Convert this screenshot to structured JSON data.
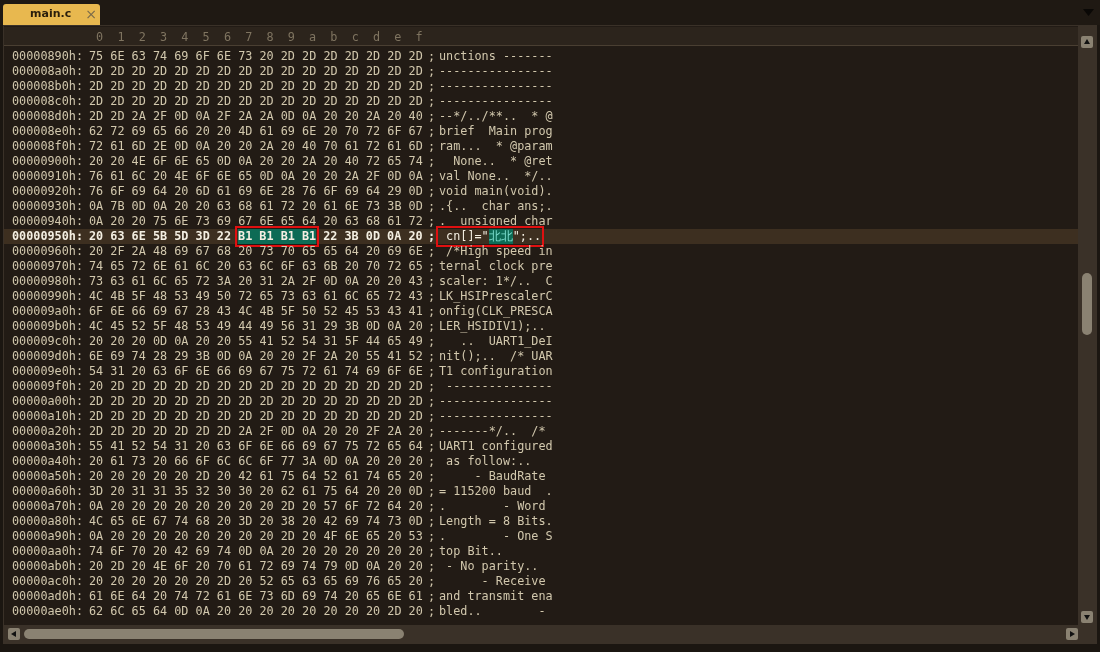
{
  "tabs": [
    {
      "label": "main.c",
      "selected": true,
      "close": "×"
    }
  ],
  "columns": [
    "0",
    "1",
    "2",
    "3",
    "4",
    "5",
    "6",
    "7",
    "8",
    "9",
    "a",
    "b",
    "c",
    "d",
    "e",
    "f"
  ],
  "rows": [
    {
      "address": "00000890h:",
      "hex": "75 6E 63 74 69 6F 6E 73 20 2D 2D 2D 2D 2D 2D 2D",
      "sep": ";",
      "ascii": "unctions -------",
      "current": false
    },
    {
      "address": "000008a0h:",
      "hex": "2D 2D 2D 2D 2D 2D 2D 2D 2D 2D 2D 2D 2D 2D 2D 2D",
      "sep": ";",
      "ascii": "----------------",
      "current": false
    },
    {
      "address": "000008b0h:",
      "hex": "2D 2D 2D 2D 2D 2D 2D 2D 2D 2D 2D 2D 2D 2D 2D 2D",
      "sep": ";",
      "ascii": "----------------",
      "current": false
    },
    {
      "address": "000008c0h:",
      "hex": "2D 2D 2D 2D 2D 2D 2D 2D 2D 2D 2D 2D 2D 2D 2D 2D",
      "sep": ";",
      "ascii": "----------------",
      "current": false
    },
    {
      "address": "000008d0h:",
      "hex": "2D 2D 2A 2F 0D 0A 2F 2A 2A 0D 0A 20 20 2A 20 40",
      "sep": ";",
      "ascii": "--*/../**..  * @",
      "current": false
    },
    {
      "address": "000008e0h:",
      "hex": "62 72 69 65 66 20 20 4D 61 69 6E 20 70 72 6F 67",
      "sep": ";",
      "ascii": "brief  Main prog",
      "current": false
    },
    {
      "address": "000008f0h:",
      "hex": "72 61 6D 2E 0D 0A 20 20 2A 20 40 70 61 72 61 6D",
      "sep": ";",
      "ascii": "ram...  * @param",
      "current": false
    },
    {
      "address": "00000900h:",
      "hex": "20 20 4E 6F 6E 65 0D 0A 20 20 2A 20 40 72 65 74",
      "sep": ";",
      "ascii": "  None..  * @ret",
      "current": false
    },
    {
      "address": "00000910h:",
      "hex": "76 61 6C 20 4E 6F 6E 65 0D 0A 20 20 2A 2F 0D 0A",
      "sep": ";",
      "ascii": "val None..  */..",
      "current": false
    },
    {
      "address": "00000920h:",
      "hex": "76 6F 69 64 20 6D 61 69 6E 28 76 6F 69 64 29 0D",
      "sep": ";",
      "ascii": "void main(void).",
      "current": false
    },
    {
      "address": "00000930h:",
      "hex": "0A 7B 0D 0A 20 20 63 68 61 72 20 61 6E 73 3B 0D",
      "sep": ";",
      "ascii": ".{..  char ans;.",
      "current": false
    },
    {
      "address": "00000940h:",
      "hex": "0A 20 20 75 6E 73 69 67 6E 65 64 20 63 68 61 72",
      "sep": ";",
      "ascii": ".  unsigned char",
      "current": false
    },
    {
      "address": "00000950h:",
      "hex": [
        {
          "text": "20 63 6E 5B 5D 3D 22",
          "selected": false
        },
        {
          "text": "B1 B1 B1 B1",
          "selected": true
        },
        {
          "text": "22 3B 0D 0A 20",
          "selected": false
        }
      ],
      "sep": ";",
      "ascii": [
        {
          "text": " cn[]=\"",
          "selected": false
        },
        {
          "text": "北北",
          "selected": true
        },
        {
          "text": "\";..",
          "selected": false
        }
      ],
      "current": true
    },
    {
      "address": "00000960h:",
      "hex": "20 2F 2A 48 69 67 68 20 73 70 65 65 64 20 69 6E",
      "sep": ";",
      "ascii": " /*High speed in",
      "current": false
    },
    {
      "address": "00000970h:",
      "hex": "74 65 72 6E 61 6C 20 63 6C 6F 63 6B 20 70 72 65",
      "sep": ";",
      "ascii": "ternal clock pre",
      "current": false
    },
    {
      "address": "00000980h:",
      "hex": "73 63 61 6C 65 72 3A 20 31 2A 2F 0D 0A 20 20 43",
      "sep": ";",
      "ascii": "scaler: 1*/..  C",
      "current": false
    },
    {
      "address": "00000990h:",
      "hex": "4C 4B 5F 48 53 49 50 72 65 73 63 61 6C 65 72 43",
      "sep": ";",
      "ascii": "LK_HSIPrescalerC",
      "current": false
    },
    {
      "address": "000009a0h:",
      "hex": "6F 6E 66 69 67 28 43 4C 4B 5F 50 52 45 53 43 41",
      "sep": ";",
      "ascii": "onfig(CLK_PRESCA",
      "current": false
    },
    {
      "address": "000009b0h:",
      "hex": "4C 45 52 5F 48 53 49 44 49 56 31 29 3B 0D 0A 20",
      "sep": ";",
      "ascii": "LER_HSIDIV1);..",
      "current": false
    },
    {
      "address": "000009c0h:",
      "hex": "20 20 20 0D 0A 20 20 55 41 52 54 31 5F 44 65 49",
      "sep": ";",
      "ascii": "   ..  UART1_DeI",
      "current": false
    },
    {
      "address": "000009d0h:",
      "hex": "6E 69 74 28 29 3B 0D 0A 20 20 2F 2A 20 55 41 52",
      "sep": ";",
      "ascii": "nit();..  /* UAR",
      "current": false
    },
    {
      "address": "000009e0h:",
      "hex": "54 31 20 63 6F 6E 66 69 67 75 72 61 74 69 6F 6E",
      "sep": ";",
      "ascii": "T1 configuration",
      "current": false
    },
    {
      "address": "000009f0h:",
      "hex": "20 2D 2D 2D 2D 2D 2D 2D 2D 2D 2D 2D 2D 2D 2D 2D",
      "sep": ";",
      "ascii": " ---------------",
      "current": false
    },
    {
      "address": "00000a00h:",
      "hex": "2D 2D 2D 2D 2D 2D 2D 2D 2D 2D 2D 2D 2D 2D 2D 2D",
      "sep": ";",
      "ascii": "----------------",
      "current": false
    },
    {
      "address": "00000a10h:",
      "hex": "2D 2D 2D 2D 2D 2D 2D 2D 2D 2D 2D 2D 2D 2D 2D 2D",
      "sep": ";",
      "ascii": "----------------",
      "current": false
    },
    {
      "address": "00000a20h:",
      "hex": "2D 2D 2D 2D 2D 2D 2D 2A 2F 0D 0A 20 20 2F 2A 20",
      "sep": ";",
      "ascii": "-------*/..  /*",
      "current": false
    },
    {
      "address": "00000a30h:",
      "hex": "55 41 52 54 31 20 63 6F 6E 66 69 67 75 72 65 64",
      "sep": ";",
      "ascii": "UART1 configured",
      "current": false
    },
    {
      "address": "00000a40h:",
      "hex": "20 61 73 20 66 6F 6C 6C 6F 77 3A 0D 0A 20 20 20",
      "sep": ";",
      "ascii": " as follow:..",
      "current": false
    },
    {
      "address": "00000a50h:",
      "hex": "20 20 20 20 20 2D 20 42 61 75 64 52 61 74 65 20",
      "sep": ";",
      "ascii": "     - BaudRate",
      "current": false
    },
    {
      "address": "00000a60h:",
      "hex": "3D 20 31 31 35 32 30 30 20 62 61 75 64 20 20 0D",
      "sep": ";",
      "ascii": "= 115200 baud  .",
      "current": false
    },
    {
      "address": "00000a70h:",
      "hex": "0A 20 20 20 20 20 20 20 20 2D 20 57 6F 72 64 20",
      "sep": ";",
      "ascii": ".        - Word",
      "current": false
    },
    {
      "address": "00000a80h:",
      "hex": "4C 65 6E 67 74 68 20 3D 20 38 20 42 69 74 73 0D",
      "sep": ";",
      "ascii": "Length = 8 Bits.",
      "current": false
    },
    {
      "address": "00000a90h:",
      "hex": "0A 20 20 20 20 20 20 20 20 2D 20 4F 6E 65 20 53",
      "sep": ";",
      "ascii": ".        - One S",
      "current": false
    },
    {
      "address": "00000aa0h:",
      "hex": "74 6F 70 20 42 69 74 0D 0A 20 20 20 20 20 20 20",
      "sep": ";",
      "ascii": "top Bit..",
      "current": false
    },
    {
      "address": "00000ab0h:",
      "hex": "20 2D 20 4E 6F 20 70 61 72 69 74 79 0D 0A 20 20",
      "sep": ";",
      "ascii": " - No parity..",
      "current": false
    },
    {
      "address": "00000ac0h:",
      "hex": "20 20 20 20 20 20 2D 20 52 65 63 65 69 76 65 20",
      "sep": ";",
      "ascii": "      - Receive",
      "current": false
    },
    {
      "address": "00000ad0h:",
      "hex": "61 6E 64 20 74 72 61 6E 73 6D 69 74 20 65 6E 61",
      "sep": ";",
      "ascii": "and transmit ena",
      "current": false
    },
    {
      "address": "00000ae0h:",
      "hex": "62 6C 65 64 0D 0A 20 20 20 20 20 20 20 20 2D 20",
      "sep": ";",
      "ascii": "bled..        -",
      "current": false
    }
  ]
}
